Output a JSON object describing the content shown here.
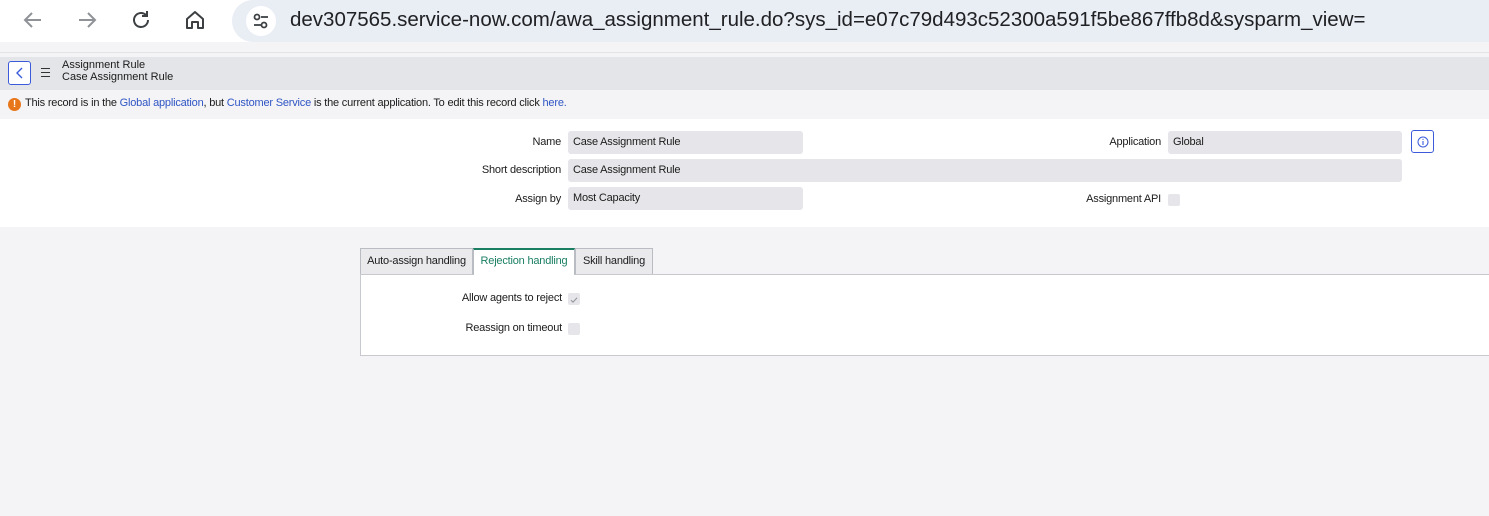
{
  "browser": {
    "back_icon": "arrow-left-icon",
    "forward_icon": "arrow-right-icon",
    "reload_icon": "reload-icon",
    "home_icon": "home-icon",
    "site_settings_icon": "site-settings-icon",
    "url": "dev307565.service-now.com/awa_assignment_rule.do?sys_id=e07c79d493c52300a591f5be867ffb8d&sysparm_view="
  },
  "header": {
    "table_name": "Assignment Rule",
    "record_name": "Case Assignment Rule"
  },
  "notice": {
    "prefix": "This record is in the ",
    "scope_link": "Global application",
    "middle": ", but ",
    "current_app_link": "Customer Service",
    "suffix": " is the current application. To edit this record click ",
    "here_link": "here."
  },
  "form": {
    "name_label": "Name",
    "name_value": "Case Assignment Rule",
    "short_description_label": "Short description",
    "short_description_value": "Case Assignment Rule",
    "assign_by_label": "Assign by",
    "assign_by_value": "Most Capacity",
    "application_label": "Application",
    "application_value": "Global",
    "assignment_api_label": "Assignment API"
  },
  "tabs": [
    {
      "label": "Auto-assign handling"
    },
    {
      "label": "Rejection handling"
    },
    {
      "label": "Skill handling"
    }
  ],
  "rejection": {
    "allow_agents_label": "Allow agents to reject",
    "allow_agents_checked": true,
    "reassign_timeout_label": "Reassign on timeout",
    "reassign_timeout_checked": false
  },
  "colors": {
    "link": "#2f55c4",
    "active_tab": "#1a7f62",
    "warning": "#e8761a"
  }
}
